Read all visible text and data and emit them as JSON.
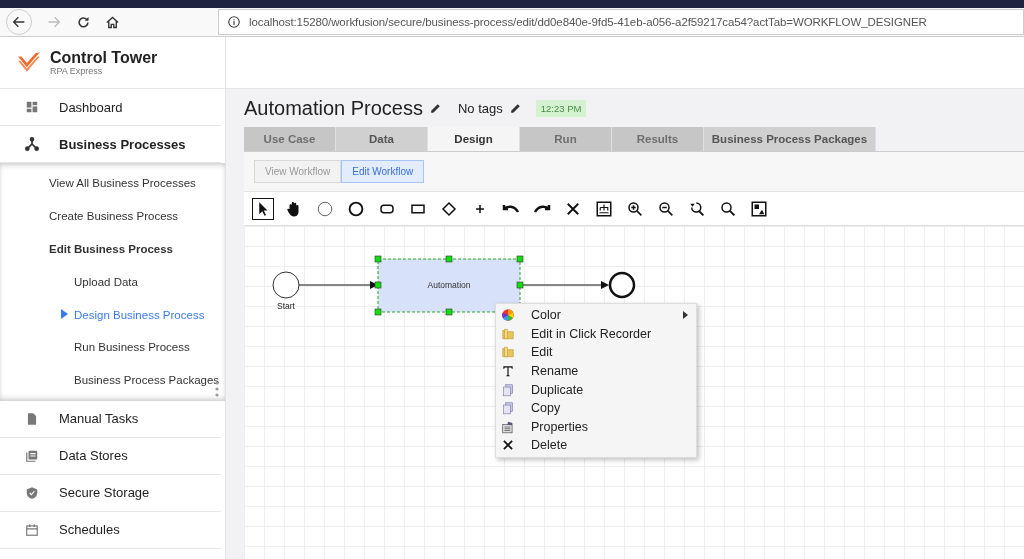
{
  "browser": {
    "url": "localhost:15280/workfusion/secure/business-process/edit/dd0e840e-9fd5-41eb-a056-a2f59217ca54?actTab=WORKFLOW_DESIGNER"
  },
  "app": {
    "title": "Control Tower",
    "subtitle": "RPA Express"
  },
  "sidebar": {
    "items": [
      {
        "label": "Dashboard",
        "kind": "dashboard",
        "selected": false
      },
      {
        "label": "Business Processes",
        "kind": "process",
        "selected": false,
        "expanded": true,
        "children": [
          {
            "label": "View All Business Processes",
            "selected": false
          },
          {
            "label": "Create Business Process",
            "selected": false
          },
          {
            "label": "Edit Business Process",
            "selected": false,
            "expanded": true,
            "children": [
              {
                "label": "Upload Data",
                "selected": false
              },
              {
                "label": "Design Business Process",
                "selected": true
              },
              {
                "label": "Run Business Process",
                "selected": false
              },
              {
                "label": "Business Process Packages",
                "selected": false
              }
            ]
          }
        ]
      },
      {
        "label": "Manual Tasks",
        "kind": "file",
        "selected": false
      },
      {
        "label": "Data Stores",
        "kind": "stores",
        "selected": false
      },
      {
        "label": "Secure Storage",
        "kind": "shield",
        "selected": false
      },
      {
        "label": "Schedules",
        "kind": "calendar",
        "selected": false
      }
    ]
  },
  "header": {
    "title": "Automation Process",
    "tags": "No tags",
    "time": "12:23 PM"
  },
  "tabs": [
    {
      "label": "Use Case",
      "selected": false,
      "disabled": true
    },
    {
      "label": "Data",
      "selected": false,
      "disabled": false
    },
    {
      "label": "Design",
      "selected": true,
      "disabled": false
    },
    {
      "label": "Run",
      "selected": false,
      "disabled": true
    },
    {
      "label": "Results",
      "selected": false,
      "disabled": true
    },
    {
      "label": "Business Process Packages",
      "selected": false,
      "disabled": false
    }
  ],
  "subtabs": [
    {
      "label": "View Workflow",
      "selected": false
    },
    {
      "label": "Edit Workflow",
      "selected": true
    }
  ],
  "tools": [
    {
      "kind": "pointer",
      "selected": true
    },
    {
      "kind": "hand",
      "selected": false
    },
    {
      "kind": "circle",
      "selected": false
    },
    {
      "kind": "thick-circle",
      "selected": false
    },
    {
      "kind": "rounded-rect",
      "selected": false
    },
    {
      "kind": "rect",
      "selected": false
    },
    {
      "kind": "diamond",
      "selected": false
    },
    {
      "kind": "plus",
      "selected": false
    },
    {
      "kind": "undo",
      "selected": false
    },
    {
      "kind": "redo",
      "selected": false
    },
    {
      "kind": "delete",
      "selected": false
    },
    {
      "kind": "layout",
      "selected": false
    },
    {
      "kind": "zoom-in",
      "selected": false
    },
    {
      "kind": "zoom-out",
      "selected": false
    },
    {
      "kind": "zoom-reset",
      "selected": false
    },
    {
      "kind": "zoom",
      "selected": false
    },
    {
      "kind": "image",
      "selected": false
    }
  ],
  "diagram": {
    "nodes": [
      {
        "kind": "start",
        "label": "Start",
        "selected": false
      },
      {
        "kind": "task",
        "label": "Automation",
        "selected": true
      },
      {
        "kind": "end",
        "selected": false
      }
    ]
  },
  "context_menu": {
    "items": [
      {
        "kind": "color",
        "label": "Color",
        "has_submenu": true
      },
      {
        "kind": "folder",
        "label": "Edit in Click Recorder",
        "has_submenu": false
      },
      {
        "kind": "folder",
        "label": "Edit",
        "has_submenu": false
      },
      {
        "kind": "text",
        "label": "Rename",
        "has_submenu": false
      },
      {
        "kind": "copy",
        "label": "Duplicate",
        "has_submenu": false
      },
      {
        "kind": "copy",
        "label": "Copy",
        "has_submenu": false
      },
      {
        "kind": "properties",
        "label": "Properties",
        "has_submenu": false
      },
      {
        "kind": "delete",
        "label": "Delete",
        "has_submenu": false
      }
    ]
  }
}
